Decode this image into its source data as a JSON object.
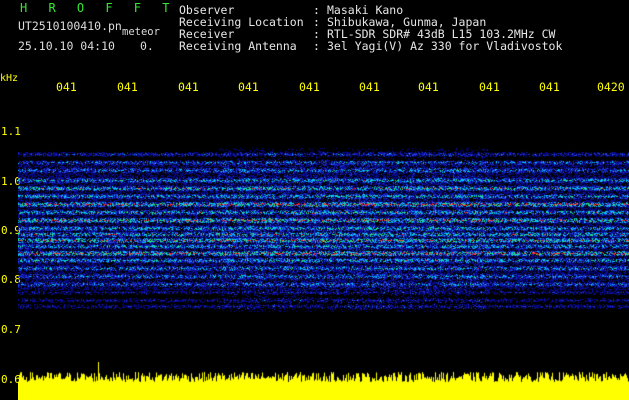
{
  "header": {
    "brand": "H R O F F T",
    "file_name": "UT2510100410.pn",
    "mode_label": "meteor",
    "datetime": "25.10.10 04:10",
    "offset": "0."
  },
  "info": [
    {
      "label": "Observer",
      "value": "Masaki Kano"
    },
    {
      "label": "Receiving Location",
      "value": "Shibukawa, Gunma, Japan"
    },
    {
      "label": "Receiver",
      "value": "RTL-SDR SDR# 43dB L15 103.2MHz CW"
    },
    {
      "label": "Receiving Antenna",
      "value": "3el Yagi(V) Az 330 for Vladivostok"
    }
  ],
  "info_colon": ":",
  "axes": {
    "y_unit": "kHz",
    "y_ticks": [
      "1.1",
      "1.0",
      "0.9",
      "0.8",
      "0.7",
      "0.6"
    ],
    "x_ticks": [
      "041",
      "041",
      "041",
      "041",
      "041",
      "041",
      "041",
      "041",
      "041",
      "0420"
    ]
  },
  "colors": {
    "background": "#000000",
    "axis_text": "#ffff00",
    "brand": "#34e834",
    "noise_floor": "#0000a0",
    "signal_strong": "#ff2020",
    "signal_mid": "#00c8ff",
    "amplitude_bar": "#ffff00"
  }
}
